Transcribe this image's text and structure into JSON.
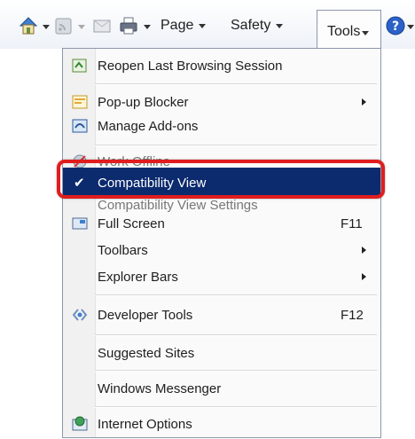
{
  "toolbar": {
    "page_label": "Page",
    "safety_label": "Safety",
    "tools_label": "Tools",
    "icons": [
      "home-icon",
      "feeds-icon",
      "read-mail-icon",
      "print-icon",
      "help-icon"
    ]
  },
  "menu": {
    "items": [
      {
        "label": "Reopen Last Browsing Session",
        "icon": "reopen-icon"
      },
      {
        "label": "Pop-up Blocker",
        "icon": "popup-blocker-icon",
        "submenu": true
      },
      {
        "label": "Manage Add-ons",
        "icon": "addons-icon"
      },
      {
        "label": "Work Offline",
        "icon": "work-offline-icon"
      },
      {
        "label": "Compatibility View",
        "checked": true,
        "selected": true
      },
      {
        "label": "Compatibility View Settings"
      },
      {
        "label": "Full Screen",
        "icon": "full-screen-icon",
        "shortcut": "F11"
      },
      {
        "label": "Toolbars",
        "submenu": true
      },
      {
        "label": "Explorer Bars",
        "submenu": true
      },
      {
        "label": "Developer Tools",
        "icon": "developer-tools-icon",
        "shortcut": "F12"
      },
      {
        "label": "Suggested Sites"
      },
      {
        "label": "Windows Messenger"
      },
      {
        "label": "Internet Options",
        "icon": "internet-options-icon"
      }
    ],
    "check_glyph": "✔"
  },
  "colors": {
    "selected_bg": "#0c2a6e",
    "highlight_border": "#e11d1d",
    "help_blue": "#2a62c9"
  }
}
